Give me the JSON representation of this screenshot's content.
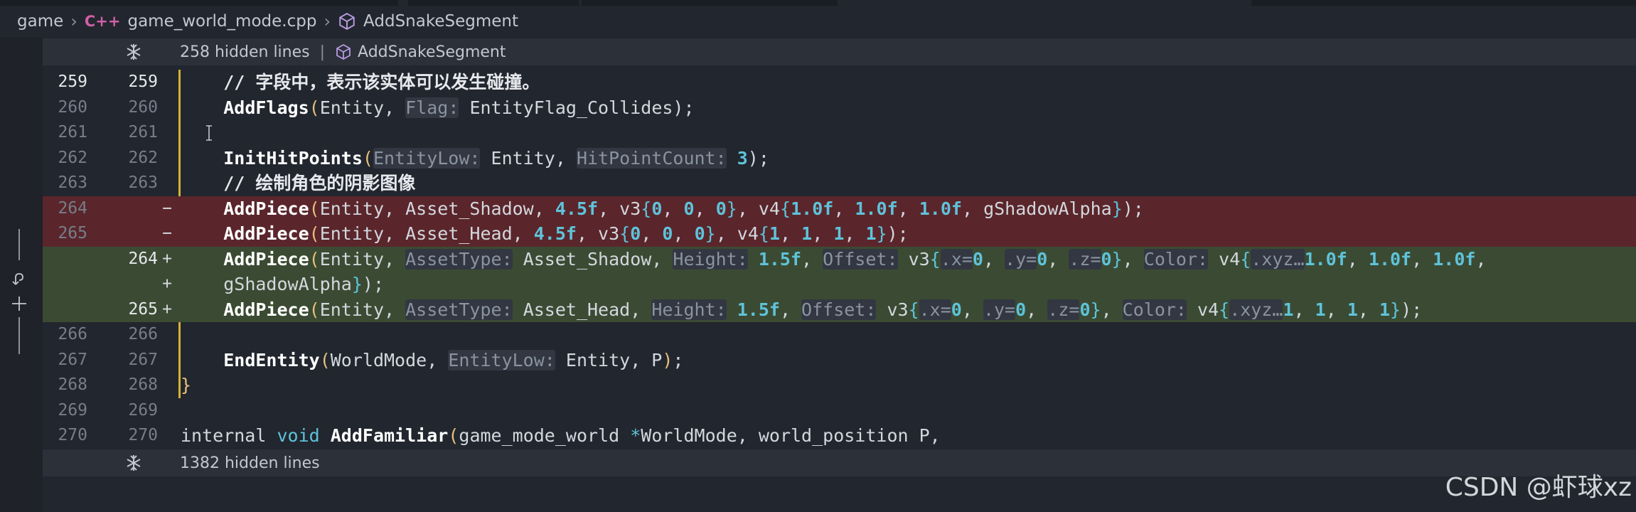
{
  "breadcrumb": {
    "folder": "game",
    "file_icon": "C++",
    "file": "game_world_mode.cpp",
    "symbol": "AddSnakeSegment"
  },
  "fold_top": {
    "text": "258 hidden lines",
    "symbol": "AddSnakeSegment"
  },
  "fold_bottom": {
    "text": "1382 hidden lines"
  },
  "lines": [
    {
      "old": "259",
      "new": "259",
      "marker": "",
      "type": "ctx",
      "current": true
    },
    {
      "old": "260",
      "new": "260",
      "marker": "",
      "type": "ctx"
    },
    {
      "old": "261",
      "new": "261",
      "marker": "",
      "type": "ctx"
    },
    {
      "old": "262",
      "new": "262",
      "marker": "",
      "type": "ctx"
    },
    {
      "old": "263",
      "new": "263",
      "marker": "",
      "type": "ctx"
    },
    {
      "old": "264",
      "new": "",
      "marker": "−",
      "type": "del"
    },
    {
      "old": "265",
      "new": "",
      "marker": "−",
      "type": "del"
    },
    {
      "old": "",
      "new": "264",
      "marker": "+",
      "type": "add"
    },
    {
      "old": "",
      "new": "",
      "marker": "+",
      "type": "add"
    },
    {
      "old": "",
      "new": "265",
      "marker": "+",
      "type": "add"
    },
    {
      "old": "266",
      "new": "266",
      "marker": "",
      "type": "ctx"
    },
    {
      "old": "267",
      "new": "267",
      "marker": "",
      "type": "ctx"
    },
    {
      "old": "268",
      "new": "268",
      "marker": "",
      "type": "ctx"
    },
    {
      "old": "269",
      "new": "269",
      "marker": "",
      "type": "ctx"
    },
    {
      "old": "270",
      "new": "270",
      "marker": "",
      "type": "ctx"
    }
  ],
  "code": {
    "l259": {
      "comment": "// 字段中，表示该实体可以发生碰撞。"
    },
    "l260": {
      "fn": "AddFlags",
      "a1": "Entity, ",
      "h1": "Flag:",
      "a2": " EntityFlag_Collides",
      "end": ");"
    },
    "l262": {
      "fn": "InitHitPoints",
      "h1": "EntityLow:",
      "a1": " Entity, ",
      "h2": "HitPointCount:",
      "n1": " 3",
      "end": ");"
    },
    "l263": {
      "comment": "// 绘制角色的阴影图像"
    },
    "l264del": {
      "fn": "AddPiece",
      "a1": "Entity, Asset_Shadow, ",
      "n1": "4.5f",
      "a2": ", v3",
      "b1": "{",
      "n2": "0",
      "c1": ", ",
      "n3": "0",
      "c2": ", ",
      "n4": "0",
      "b2": "}",
      "a3": ", v4",
      "b3": "{",
      "n5": "1.0f",
      "c3": ", ",
      "n6": "1.0f",
      "c4": ", ",
      "n7": "1.0f",
      "a4": ", gShadowAlpha",
      "b4": "}",
      "end": ");"
    },
    "l265del": {
      "fn": "AddPiece",
      "a1": "Entity, Asset_Head, ",
      "n1": "4.5f",
      "a2": ", v3",
      "b1": "{",
      "n2": "0",
      "c1": ", ",
      "n3": "0",
      "c2": ", ",
      "n4": "0",
      "b2": "}",
      "a3": ", v4",
      "b3": "{",
      "n5": "1",
      "c3": ", ",
      "n6": "1",
      "c4": ", ",
      "n7": "1",
      "c5": ", ",
      "n8": "1",
      "b4": "}",
      "end": ");"
    },
    "l264add": {
      "fn": "AddPiece",
      "a1": "Entity, ",
      "h1": "AssetType:",
      "a2": " Asset_Shadow, ",
      "h2": "Height:",
      "n1": " 1.5f",
      "a3": ", ",
      "h3": "Offset:",
      "a4": " v3",
      "b1": "{",
      "h4": ".x=",
      "n2": "0",
      "c1": ", ",
      "h5": ".y=",
      "n3": "0",
      "c2": ", ",
      "h6": ".z=",
      "n4": "0",
      "b2": "}",
      "a5": ", ",
      "h7": "Color:",
      "a6": " v4",
      "b3": "{",
      "h8": ".xyz…",
      "n5": "1.0f",
      "c3": ", ",
      "n6": "1.0f",
      "c4": ", ",
      "n7": "1.0f",
      "c5": ","
    },
    "l264wrap": {
      "a1": "gShadowAlpha",
      "b1": "}",
      "end": ");"
    },
    "l265add": {
      "fn": "AddPiece",
      "a1": "Entity, ",
      "h1": "AssetType:",
      "a2": " Asset_Head, ",
      "h2": "Height:",
      "n1": " 1.5f",
      "a3": ", ",
      "h3": "Offset:",
      "a4": " v3",
      "b1": "{",
      "h4": ".x=",
      "n2": "0",
      "c1": ", ",
      "h5": ".y=",
      "n3": "0",
      "c2": ", ",
      "h6": ".z=",
      "n4": "0",
      "b2": "}",
      "a5": ", ",
      "h7": "Color:",
      "a6": " v4",
      "b3": "{",
      "h8": ".xyz…",
      "n5": "1",
      "c3": ", ",
      "n6": "1",
      "c4": ", ",
      "n7": "1",
      "c5": ", ",
      "n8": "1",
      "b4": "}",
      "end": ");"
    },
    "l267": {
      "fn": "EndEntity",
      "p1": "(",
      "a1": "WorldMode, ",
      "h1": "EntityLow:",
      "a2": " Entity, P",
      "p2": ")",
      "end": ";"
    },
    "l268": {
      "brace": "}"
    },
    "l270": {
      "a1": "internal ",
      "kw": "void",
      "a2": " ",
      "fn": "AddFamiliar",
      "p1": "(",
      "a3": "game_mode_world ",
      "ptr": "*",
      "a4": "WorldMode, world_position P,"
    }
  },
  "watermark": "CSDN @虾球xz"
}
